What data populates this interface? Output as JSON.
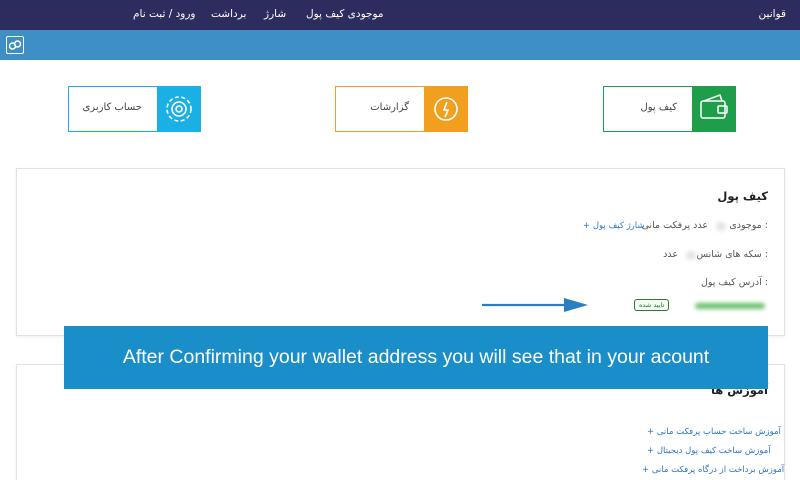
{
  "nav": {
    "rules": "قوانین",
    "wallet_balance": "موجودی کیف پول",
    "charge": "شارژ",
    "withdraw": "برداشت",
    "login_register": "ورود / ثبت نام"
  },
  "tiles": {
    "account": "حساب کاربری",
    "reports": "گزارشات",
    "wallet": "کیف پول"
  },
  "wallet_section": {
    "title": "کیف پول",
    "balance_label": "موجودی :",
    "balance_unit": "عدد پرفکت مانی",
    "charge_link": "+ شارژ کیف پول",
    "coins_label": "سکه های شانس :",
    "coins_unit": "عدد",
    "address_label": "آدرس کیف پول :",
    "verified_badge": "تایید شده"
  },
  "tutorials_section": {
    "title": "آموزش ها",
    "links": [
      "+ آموزش ساخت حساب پرفکت مانی",
      "+ آموزش ساخت کیف پول دیجیتال",
      "+ آموزش برداخت از درگاه پرفکت مانی"
    ]
  },
  "banner": {
    "text": "After Confirming your wallet address you will see that in your acount"
  },
  "colors": {
    "nav_bg": "#2c2c5e",
    "bar_bg": "#3d8fc6",
    "account_tile": "#1ab0e6",
    "reports_tile": "#f0a01e",
    "wallet_tile": "#1e9d4a",
    "banner_bg": "#1a8ec9",
    "link": "#2b74c4"
  }
}
